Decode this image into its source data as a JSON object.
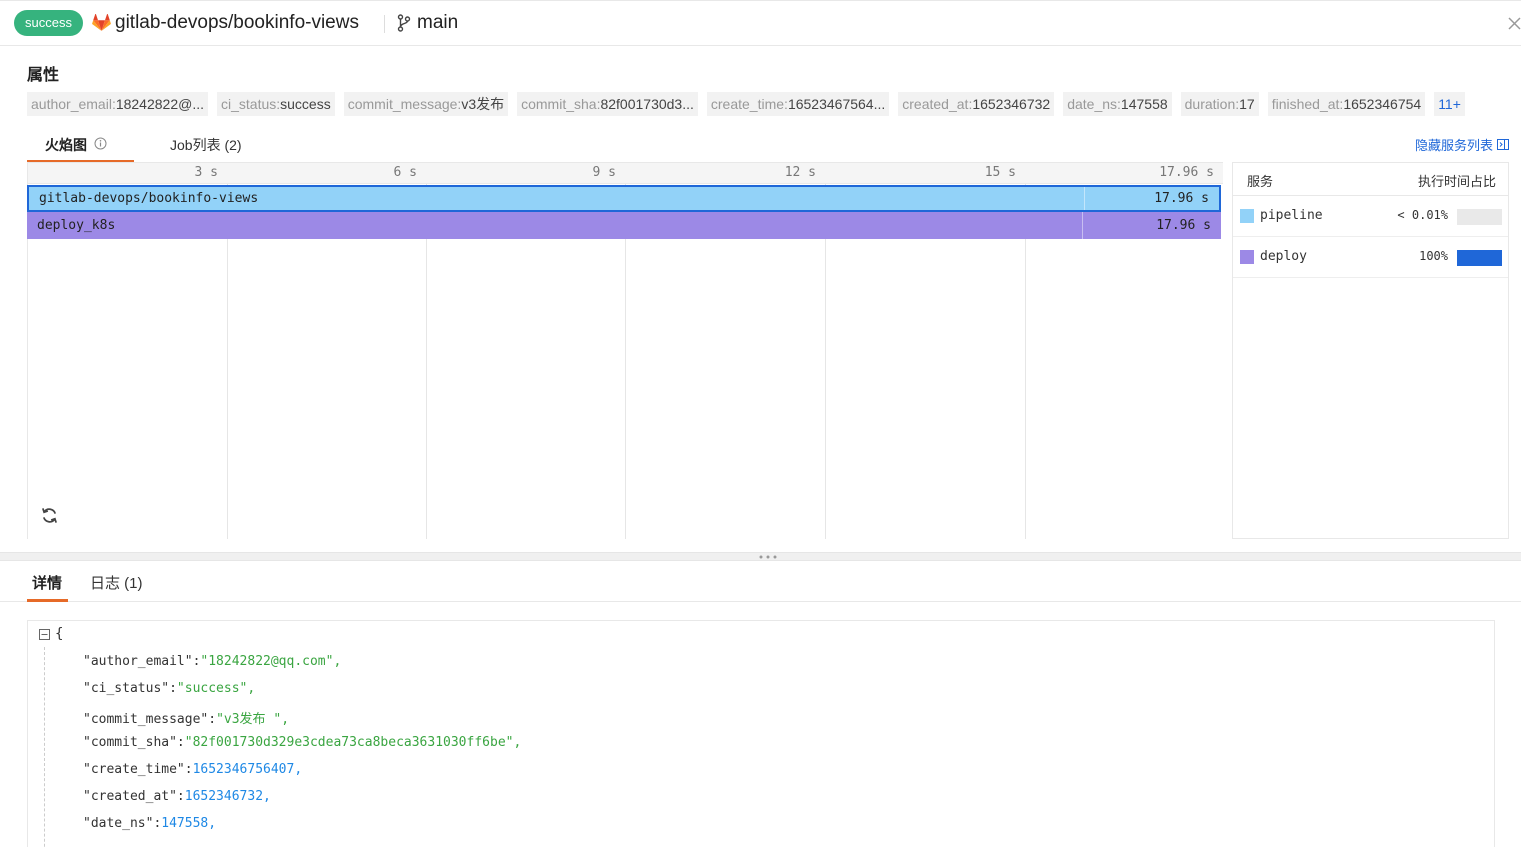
{
  "header": {
    "status": "success",
    "repo": "gitlab-devops/bookinfo-views",
    "branch": "main",
    "colors": {
      "status": "#36b37e",
      "accent": "#1f67d8",
      "tab_underline": "#e66a28"
    }
  },
  "properties": {
    "title": "属性",
    "tags": [
      {
        "key": "author_email",
        "value": "18242822@..."
      },
      {
        "key": "ci_status",
        "value": "success"
      },
      {
        "key": "commit_message",
        "value": "v3发布"
      },
      {
        "key": "commit_sha",
        "value": "82f001730d3..."
      },
      {
        "key": "create_time",
        "value": "16523467564..."
      },
      {
        "key": "created_at",
        "value": "1652346732"
      },
      {
        "key": "date_ns",
        "value": "147558"
      },
      {
        "key": "duration",
        "value": "17"
      },
      {
        "key": "finished_at",
        "value": "1652346754"
      }
    ],
    "more": "11+"
  },
  "tabs_top": {
    "flame": "火焰图",
    "jobs": "Job列表 (2)",
    "hide_services": "隐藏服务列表"
  },
  "flame": {
    "ticks": [
      "3 s",
      "6 s",
      "9 s",
      "12 s",
      "15 s",
      "17.96 s"
    ],
    "bars": [
      {
        "label": "gitlab-devops/bookinfo-views",
        "time": "17.96 s",
        "color": "#92d2f8"
      },
      {
        "label": "deploy_k8s",
        "time": "17.96 s",
        "color": "#9c89e6"
      }
    ]
  },
  "services": {
    "col_service": "服务",
    "col_ratio": "执行时间占比",
    "rows": [
      {
        "name": "pipeline",
        "pct": "< 0.01%",
        "ratio": 0.0001,
        "color": "#92d2f8"
      },
      {
        "name": "deploy",
        "pct": "100%",
        "ratio": 1.0,
        "color": "#9c89e6"
      }
    ]
  },
  "tabs_bottom": {
    "detail": "详情",
    "logs": "日志 (1)"
  },
  "json": {
    "open": "{",
    "lines": [
      {
        "k": "\"author_email\"",
        "v": "\"18242822@qq.com\",",
        "t": "s"
      },
      {
        "k": "\"ci_status\"",
        "v": "\"success\",",
        "t": "s"
      },
      {
        "k": "\"commit_message\"",
        "v": "\"v3发布 \",",
        "t": "s"
      },
      {
        "k": "\"commit_sha\"",
        "v": "\"82f001730d329e3cdea73ca8beca3631030ff6be\",",
        "t": "s"
      },
      {
        "k": "\"create_time\"",
        "v": "1652346756407,",
        "t": "n"
      },
      {
        "k": "\"created_at\"",
        "v": "1652346732,",
        "t": "n"
      },
      {
        "k": "\"date_ns\"",
        "v": "147558,",
        "t": "n"
      }
    ]
  }
}
